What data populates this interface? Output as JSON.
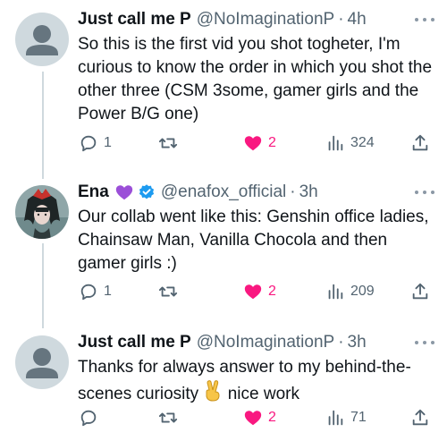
{
  "tweets": [
    {
      "name": "Just call me P",
      "handle": "@NoImaginationP",
      "time": "4h",
      "text": "So this is the first vid you shot togheter, I'm curious to know the order in which you shot the other three (CSM 3some, gamer girls and the Power B/G one)",
      "replies": "1",
      "retweets": "",
      "likes": "2",
      "views": "324",
      "liked": true
    },
    {
      "name": "Ena",
      "handle": "@enafox_official",
      "time": "3h",
      "text": "Our collab went like this: Genshin office ladies, Chainsaw Man, Vanilla Chocola and then gamer girls :)",
      "replies": "1",
      "retweets": "",
      "likes": "2",
      "views": "209",
      "liked": true,
      "verified": true,
      "name_emoji": "purple-heart"
    },
    {
      "name": "Just call me P",
      "handle": "@NoImaginationP",
      "time": "3h",
      "text_part1": "Thanks for always answer to my behind-the-scenes curiosity",
      "text_part2": " nice work",
      "text_emoji": "victory-hand",
      "replies": "",
      "retweets": "",
      "likes": "2",
      "views": "71",
      "liked": true
    }
  ],
  "colors": {
    "text": "#0f1419",
    "secondary": "#536471",
    "like": "#f91880",
    "verified": "#1d9bf0",
    "thread_line": "#cfd9de",
    "avatar_default": "#cfd9de"
  },
  "separator": "·"
}
